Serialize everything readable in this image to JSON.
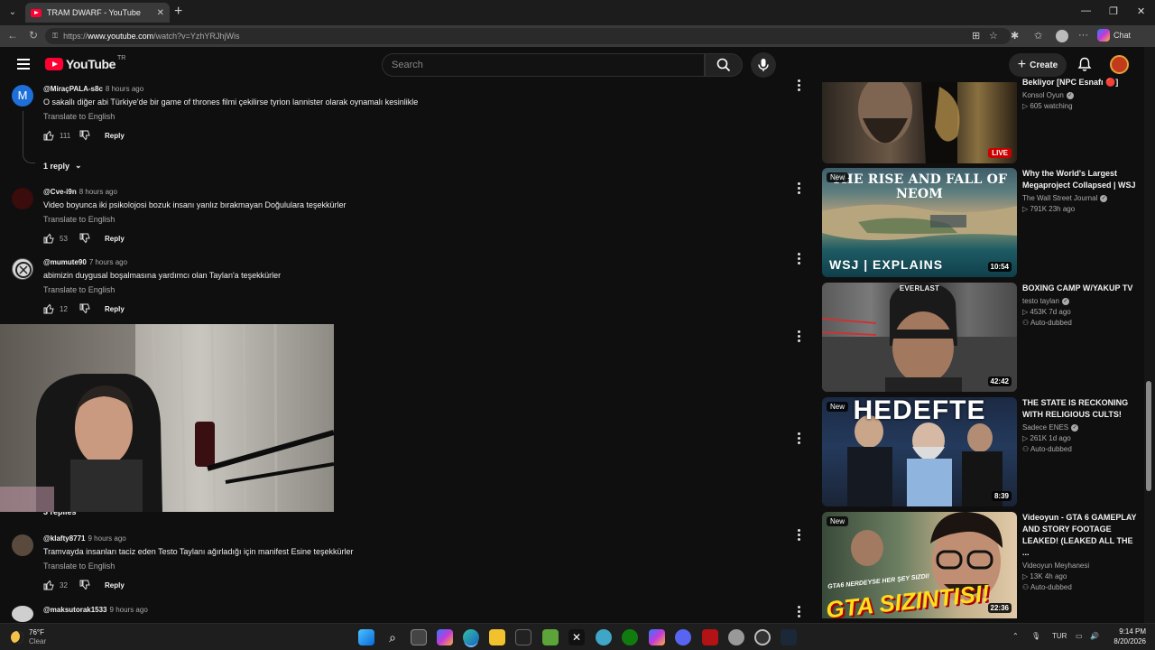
{
  "browser": {
    "tab_title": "TRAM DWARF - YouTube",
    "url_prefix": "https://",
    "url_host": "www.youtube.com",
    "url_path": "/watch?v=YzhYRJhjWis",
    "chat_label": "Chat"
  },
  "header": {
    "logo_text": "YouTube",
    "country_code": "TR",
    "search_placeholder": "Search",
    "create_label": "Create"
  },
  "comments": [
    {
      "handle": "@MiraçPALA-s8c",
      "time": "8 hours ago",
      "text": "O sakallı diğer abi Türkiye'de bir game of thrones filmi çekilirse tyrion lannister olarak oynamalı kesinlikle",
      "translate": "Translate to English",
      "likes": "111",
      "reply": "Reply"
    },
    {
      "handle": "@Cve-i9n",
      "time": "8 hours ago",
      "text": "Video boyunca iki psikolojosi bozuk insanı yanlız bırakmayan Doğululara teşekkürler",
      "translate": "Translate to English",
      "likes": "53",
      "reply": "Reply"
    },
    {
      "handle": "@mumute90",
      "time": "7 hours ago",
      "text": "abimizin duygusal boşalmasına yardımcı olan Taylan'a teşekkürler",
      "translate": "Translate to English",
      "likes": "12",
      "reply": "Reply"
    },
    {
      "handle": "@klafty8771",
      "time": "9 hours ago",
      "text": "Tramvayda insanları taciz eden Testo Taylanı ağırladığı için manifest Esine teşekkürler",
      "translate": "Translate to English",
      "likes": "32",
      "reply": "Reply"
    },
    {
      "handle": "@maksutorak1533",
      "time": "9 hours ago"
    }
  ],
  "reply_toggle": "1 reply",
  "replies_partial": "3 replies",
  "sidebar": [
    {
      "title": "Bekliyor [NPC Esnafı 🔴]",
      "channel": "Konsol Oyun",
      "stats": "605 watching",
      "badge": "LIVE"
    },
    {
      "title": "Why the World's Largest Megaproject Collapsed | WSJ",
      "channel": "The Wall Street Journal",
      "stats": "791K  23h ago",
      "duration": "10:54",
      "badge": "New",
      "thumb_text": "THE RISE AND FALL OF NEOM",
      "thumb_brand": "WSJ | EXPLAINS"
    },
    {
      "title": "BOXING CAMP W/YAKUP TV",
      "channel": "testo taylan",
      "stats": "453K  7d ago",
      "extra": "Auto-dubbed",
      "duration": "42:42",
      "thumb_text": "EVERLAST"
    },
    {
      "title": "THE STATE IS RECKONING WITH RELIGIOUS CULTS!",
      "channel": "Sadece ENES",
      "stats": "261K  1d ago",
      "extra": "Auto-dubbed",
      "duration": "8:39",
      "badge": "New",
      "thumb_text": "HEDEFTE"
    },
    {
      "title": "Videoyun - GTA 6 GAMEPLAY AND STORY FOOTAGE LEAKED! (LEAKED ALL THE ...",
      "channel": "Videoyun Meyhanesi",
      "stats": "13K  4h ago",
      "extra": "Auto-dubbed",
      "duration": "22:36",
      "badge": "New",
      "thumb_text": "GTA SIZINTISI!",
      "thumb_sub": "GTA6 NERDEYSE HER ŞEY SIZDI!"
    }
  ],
  "taskbar": {
    "temp": "76°F",
    "condition": "Clear",
    "lang": "TUR",
    "time": "9:14 PM",
    "date": "8/20/2026"
  }
}
